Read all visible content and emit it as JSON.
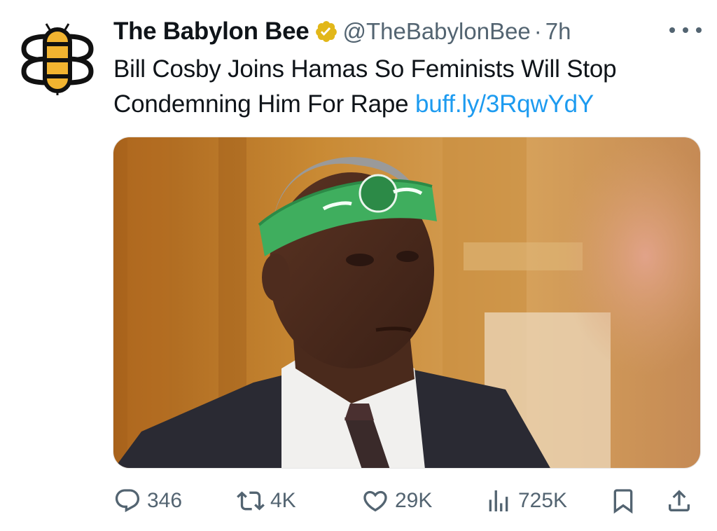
{
  "tweet": {
    "author_name": "The Babylon Bee",
    "handle": "@TheBabylonBee",
    "separator": "·",
    "time": "7h",
    "text": "Bill Cosby Joins Hamas So Feminists Will Stop Condemning Him For Rape",
    "link": "buff.ly/3RqwYdY",
    "verified": true,
    "verified_color": "#e2b719",
    "link_color": "#1d9bf0",
    "avatar_icon": "bee-logo-icon",
    "media_description_visible_text": "",
    "stats": {
      "replies": "346",
      "retweets": "4K",
      "likes": "29K",
      "views": "725K"
    }
  },
  "icons": {
    "more": "more-dots-icon",
    "reply": "reply-icon",
    "retweet": "retweet-icon",
    "like": "heart-icon",
    "views": "views-icon",
    "bookmark": "bookmark-icon",
    "share": "share-icon"
  },
  "colors": {
    "text": "#0f1419",
    "secondary": "#536471",
    "bee_yellow": "#f2b430"
  }
}
